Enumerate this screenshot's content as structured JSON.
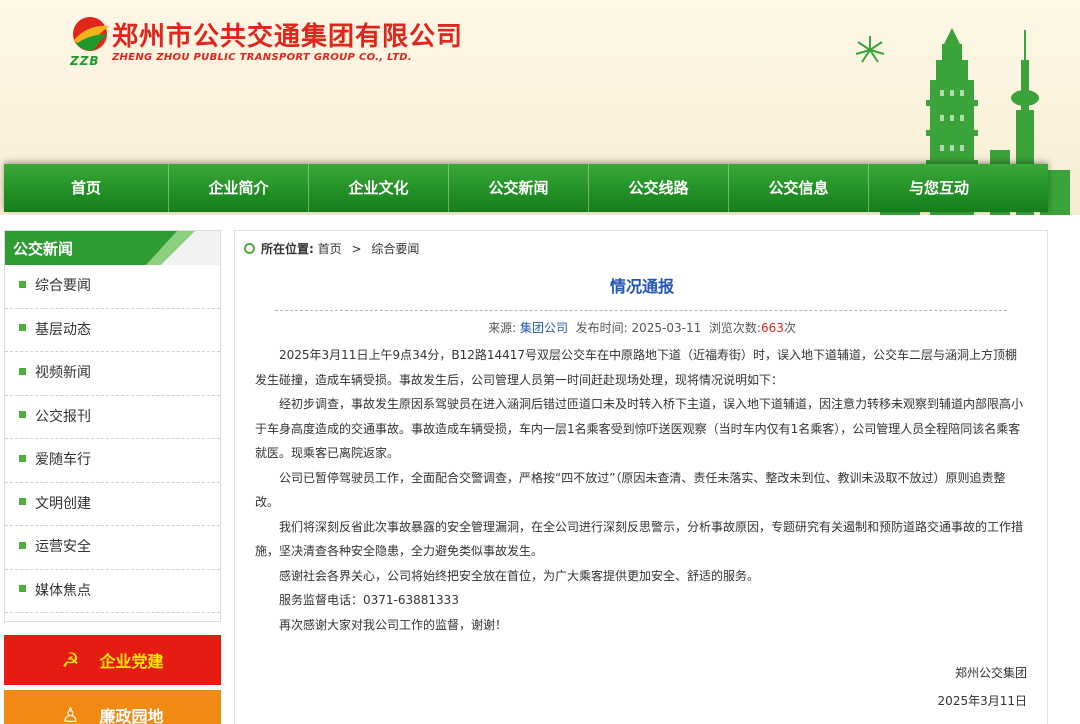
{
  "header": {
    "logo_abbr": "ZZB",
    "company_cn": "郑州市公共交通集团有限公司",
    "company_en": "ZHENG ZHOU PUBLIC TRANSPORT GROUP CO., LTD."
  },
  "nav": {
    "items": [
      "首页",
      "企业简介",
      "企业文化",
      "公交新闻",
      "公交线路",
      "公交信息",
      "与您互动"
    ]
  },
  "sidebar": {
    "title": "公交新闻",
    "items": [
      "综合要闻",
      "基层动态",
      "视频新闻",
      "公交报刊",
      "爱随车行",
      "文明创建",
      "运营安全",
      "媒体焦点"
    ],
    "party_button": "企业党建",
    "integrity_button": "廉政园地"
  },
  "breadcrumb": {
    "label": "所在位置:",
    "home": "首页",
    "separator": ">",
    "current": "综合要闻"
  },
  "article": {
    "title": "情况通报",
    "source_label": "来源:",
    "source": "集团公司",
    "date_label": "发布时间:",
    "date": "2025-03-11",
    "views_label": "浏览次数:",
    "views": "663",
    "views_unit": "次",
    "paragraphs": [
      "2025年3月11日上午9点34分，B12路14417号双层公交车在中原路地下道（近福寿街）时，误入地下道辅道，公交车二层与涵洞上方顶棚发生碰撞，造成车辆受损。事故发生后，公司管理人员第一时间赶赴现场处理，现将情况说明如下：",
      "经初步调查，事故发生原因系驾驶员在进入涵洞后错过匝道口未及时转入桥下主道，误入地下道辅道，因注意力转移未观察到辅道内部限高小于车身高度造成的交通事故。事故造成车辆受损，车内一层1名乘客受到惊吓送医观察（当时车内仅有1名乘客），公司管理人员全程陪同该名乘客就医。现乘客已离院返家。",
      "公司已暂停驾驶员工作，全面配合交警调查，严格按“四不放过”（原因未查清、责任未落实、整改未到位、教训未汲取不放过）原则追责整改。",
      "我们将深刻反省此次事故暴露的安全管理漏洞，在全公司进行深刻反思警示，分析事故原因，专题研究有关遏制和预防道路交通事故的工作措施，坚决清查各种安全隐患，全力避免类似事故发生。",
      "感谢社会各界关心，公司将始终把安全放在首位，为广大乘客提供更加安全、舒适的服务。",
      "服务监督电话：0371-63881333",
      "再次感谢大家对我公司工作的监督，谢谢！"
    ],
    "signature": "郑州公交集团",
    "signature_date": "2025年3月11日"
  },
  "colors": {
    "nav_green": "#239126",
    "company_red": "#e0261b",
    "title_blue": "#2457b4",
    "party_red": "#e51c12",
    "integrity_orange": "#f08a12"
  }
}
